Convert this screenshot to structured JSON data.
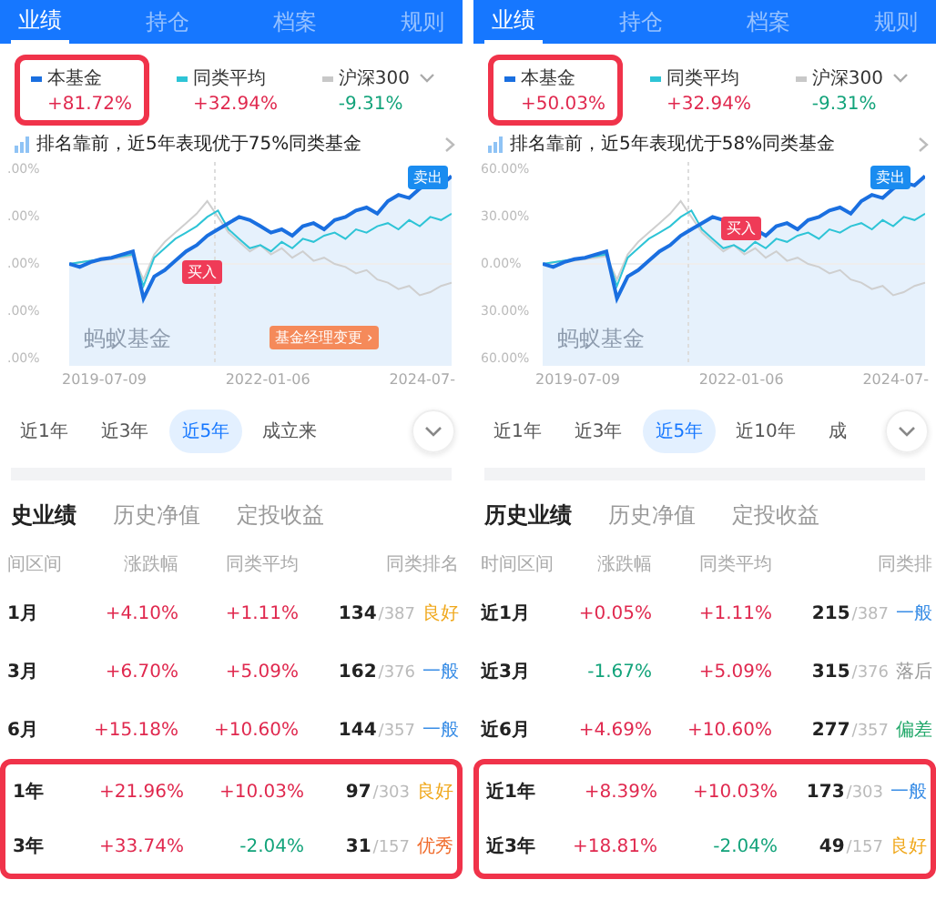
{
  "panels": [
    {
      "tabs": [
        {
          "label": "业绩",
          "selected": true
        },
        {
          "label": "持仓",
          "selected": false
        },
        {
          "label": "档案",
          "selected": false
        },
        {
          "label": "规则",
          "selected": false
        }
      ],
      "legend": [
        {
          "name": "本基金",
          "value": "+81.72%",
          "up": true,
          "color": "#1a6fe0",
          "highlighted": true,
          "dropdown": false
        },
        {
          "name": "同类平均",
          "value": "+32.94%",
          "up": true,
          "color": "#2ec4d6",
          "highlighted": false,
          "dropdown": false
        },
        {
          "name": "沪深300",
          "value": "-9.31%",
          "up": false,
          "color": "#c8c8c8",
          "highlighted": false,
          "dropdown": true
        }
      ],
      "ranking": "排名靠前，近5年表现优于75%同类基金",
      "chart": {
        "yticks": [
          ".00%",
          ".00%",
          ".00%",
          ".00%",
          ".00%"
        ],
        "xlabels": [
          "2019-07-09",
          "2022-01-06",
          "2024-07-"
        ],
        "markers": [
          {
            "kind": "sell",
            "label": "卖出"
          },
          {
            "kind": "buy",
            "label": "买入"
          },
          {
            "kind": "manager",
            "label": "基金经理变更 ›"
          }
        ],
        "watermark": "蚂蚁基金"
      },
      "periods": [
        {
          "label": "近1年",
          "selected": false
        },
        {
          "label": "近3年",
          "selected": false
        },
        {
          "label": "近5年",
          "selected": true
        },
        {
          "label": "成立来",
          "selected": false
        }
      ],
      "subtabs": [
        {
          "label": "史业绩",
          "selected": true
        },
        {
          "label": "历史净值",
          "selected": false
        },
        {
          "label": "定投收益",
          "selected": false
        }
      ],
      "table": {
        "columns": [
          "间区间",
          "涨跌幅",
          "同类平均",
          "同类排名"
        ],
        "rows": [
          {
            "period": "1月",
            "change": {
              "text": "+4.10%",
              "up": true
            },
            "avg": {
              "text": "+1.11%",
              "up": true
            },
            "rank": "134",
            "total": "/387",
            "rating": "良好",
            "color": "#f0a81c",
            "highlighted": false
          },
          {
            "period": "3月",
            "change": {
              "text": "+6.70%",
              "up": true
            },
            "avg": {
              "text": "+5.09%",
              "up": true
            },
            "rank": "162",
            "total": "/376",
            "rating": "一般",
            "color": "#3a8ee6",
            "highlighted": false
          },
          {
            "period": "6月",
            "change": {
              "text": "+15.18%",
              "up": true
            },
            "avg": {
              "text": "+10.60%",
              "up": true
            },
            "rank": "144",
            "total": "/357",
            "rating": "一般",
            "color": "#3a8ee6",
            "highlighted": false
          },
          {
            "period": "1年",
            "change": {
              "text": "+21.96%",
              "up": true
            },
            "avg": {
              "text": "+10.03%",
              "up": true
            },
            "rank": "97",
            "total": "/303",
            "rating": "良好",
            "color": "#f0a81c",
            "highlighted": true
          },
          {
            "period": "3年",
            "change": {
              "text": "+33.74%",
              "up": true
            },
            "avg": {
              "text": "-2.04%",
              "up": false
            },
            "rank": "31",
            "total": "/157",
            "rating": "优秀",
            "color": "#f06a2a",
            "highlighted": true
          }
        ]
      }
    },
    {
      "tabs": [
        {
          "label": "业绩",
          "selected": true
        },
        {
          "label": "持仓",
          "selected": false
        },
        {
          "label": "档案",
          "selected": false
        },
        {
          "label": "规则",
          "selected": false
        }
      ],
      "legend": [
        {
          "name": "本基金",
          "value": "+50.03%",
          "up": true,
          "color": "#1a6fe0",
          "highlighted": true,
          "dropdown": false
        },
        {
          "name": "同类平均",
          "value": "+32.94%",
          "up": true,
          "color": "#2ec4d6",
          "highlighted": false,
          "dropdown": false
        },
        {
          "name": "沪深300",
          "value": "-9.31%",
          "up": false,
          "color": "#c8c8c8",
          "highlighted": false,
          "dropdown": true
        }
      ],
      "ranking": "排名靠前，近5年表现优于58%同类基金",
      "chart": {
        "yticks": [
          "60.00%",
          "30.00%",
          "0.00%",
          "30.00%",
          "60.00%"
        ],
        "xlabels": [
          "2019-07-09",
          "2022-01-06",
          "2024-07-"
        ],
        "markers": [
          {
            "kind": "sell",
            "label": "卖出"
          },
          {
            "kind": "buy",
            "label": "买入"
          }
        ],
        "watermark": "蚂蚁基金"
      },
      "periods": [
        {
          "label": "近1年",
          "selected": false
        },
        {
          "label": "近3年",
          "selected": false
        },
        {
          "label": "近5年",
          "selected": true
        },
        {
          "label": "近10年",
          "selected": false
        },
        {
          "label": "成",
          "selected": false
        }
      ],
      "subtabs": [
        {
          "label": "历史业绩",
          "selected": true
        },
        {
          "label": "历史净值",
          "selected": false
        },
        {
          "label": "定投收益",
          "selected": false
        }
      ],
      "table": {
        "columns": [
          "时间区间",
          "涨跌幅",
          "同类平均",
          "同类排"
        ],
        "rows": [
          {
            "period": "近1月",
            "change": {
              "text": "+0.05%",
              "up": true
            },
            "avg": {
              "text": "+1.11%",
              "up": true
            },
            "rank": "215",
            "total": "/387",
            "rating": "一般",
            "color": "#3a8ee6",
            "highlighted": false
          },
          {
            "period": "近3月",
            "change": {
              "text": "-1.67%",
              "up": false
            },
            "avg": {
              "text": "+5.09%",
              "up": true
            },
            "rank": "315",
            "total": "/376",
            "rating": "落后",
            "color": "#999999",
            "highlighted": false
          },
          {
            "period": "近6月",
            "change": {
              "text": "+4.69%",
              "up": true
            },
            "avg": {
              "text": "+10.60%",
              "up": true
            },
            "rank": "277",
            "total": "/357",
            "rating": "偏差",
            "color": "#22a86a",
            "highlighted": false
          },
          {
            "period": "近1年",
            "change": {
              "text": "+8.39%",
              "up": true
            },
            "avg": {
              "text": "+10.03%",
              "up": true
            },
            "rank": "173",
            "total": "/303",
            "rating": "一般",
            "color": "#3a8ee6",
            "highlighted": true
          },
          {
            "period": "近3年",
            "change": {
              "text": "+18.81%",
              "up": true
            },
            "avg": {
              "text": "-2.04%",
              "up": false
            },
            "rank": "49",
            "total": "/157",
            "rating": "良好",
            "color": "#f0a81c",
            "highlighted": true
          }
        ]
      }
    }
  ]
}
